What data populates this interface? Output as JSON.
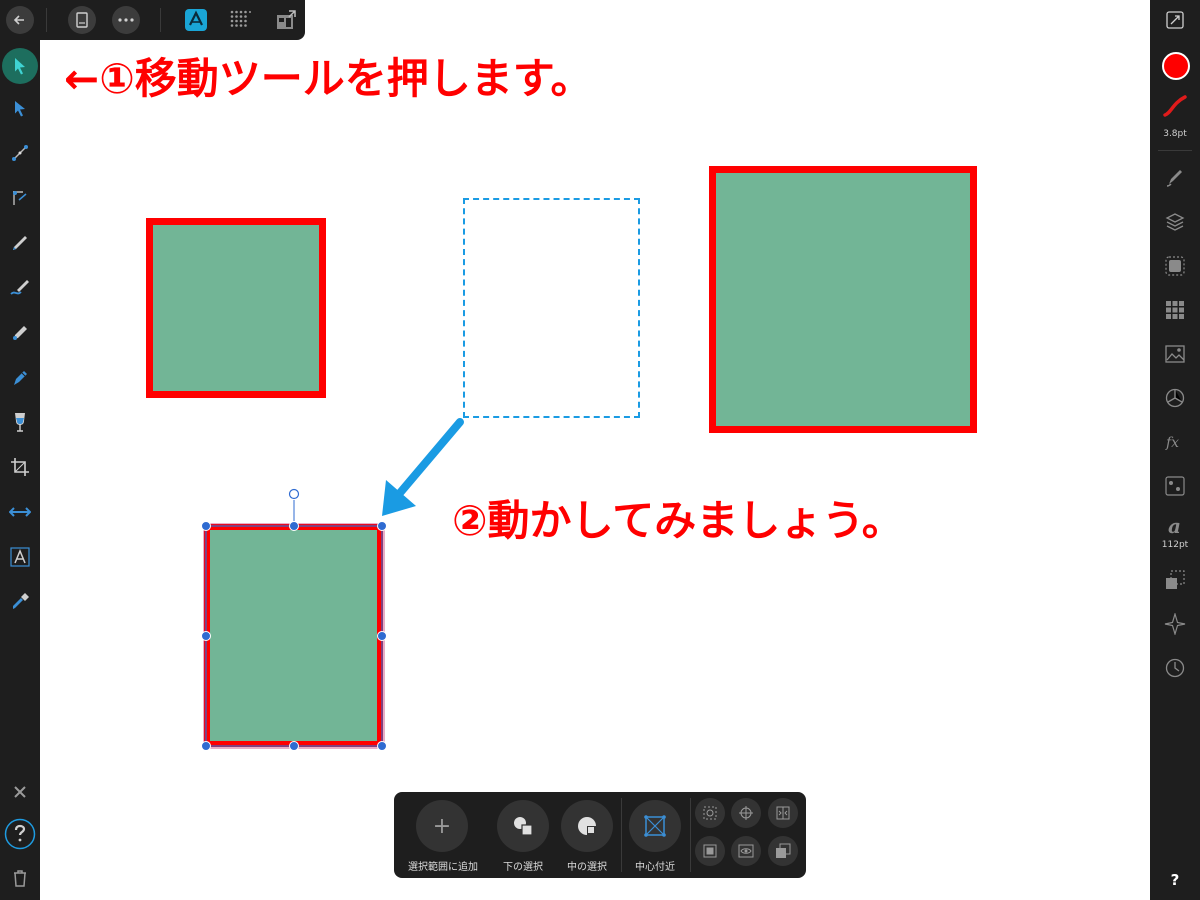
{
  "toolbar": {
    "icons": [
      "back-arrow-icon",
      "document-icon",
      "more-icon",
      "designer-persona-icon",
      "pixel-persona-icon",
      "export-persona-icon"
    ]
  },
  "tools": [
    "move-tool-icon",
    "node-tool-icon",
    "pen-tool-icon",
    "corner-tool-icon",
    "pencil-tool-icon",
    "vector-brush-icon",
    "fill-tool-icon",
    "paint-brush-icon",
    "transparency-tool-icon",
    "crop-tool-icon",
    "view-tool-icon",
    "text-tool-icon",
    "eyedropper-icon"
  ],
  "left_bottom": [
    "close-icon",
    "help-snapping-icon",
    "trash-icon"
  ],
  "studio": {
    "stroke_width": "3.8pt",
    "text_size": "112pt",
    "help_label": "?",
    "accent_color": "#ff0000",
    "active_tool_color": "#1d6e5e"
  },
  "canvas": {
    "annotation1": "←①移動ツールを押します。",
    "annotation2": "②動かしてみましょう。",
    "fill_color": "#72b596",
    "stroke_color": "#ff0000",
    "selection_color": "#2f6bd1",
    "arrow_color": "#1a9be3"
  },
  "context_toolbar": {
    "add_to_selection": "選択範囲に追加",
    "add_symbol": "+",
    "select_below": "下の選択",
    "select_inside": "中の選択",
    "near_center": "中心付近"
  }
}
